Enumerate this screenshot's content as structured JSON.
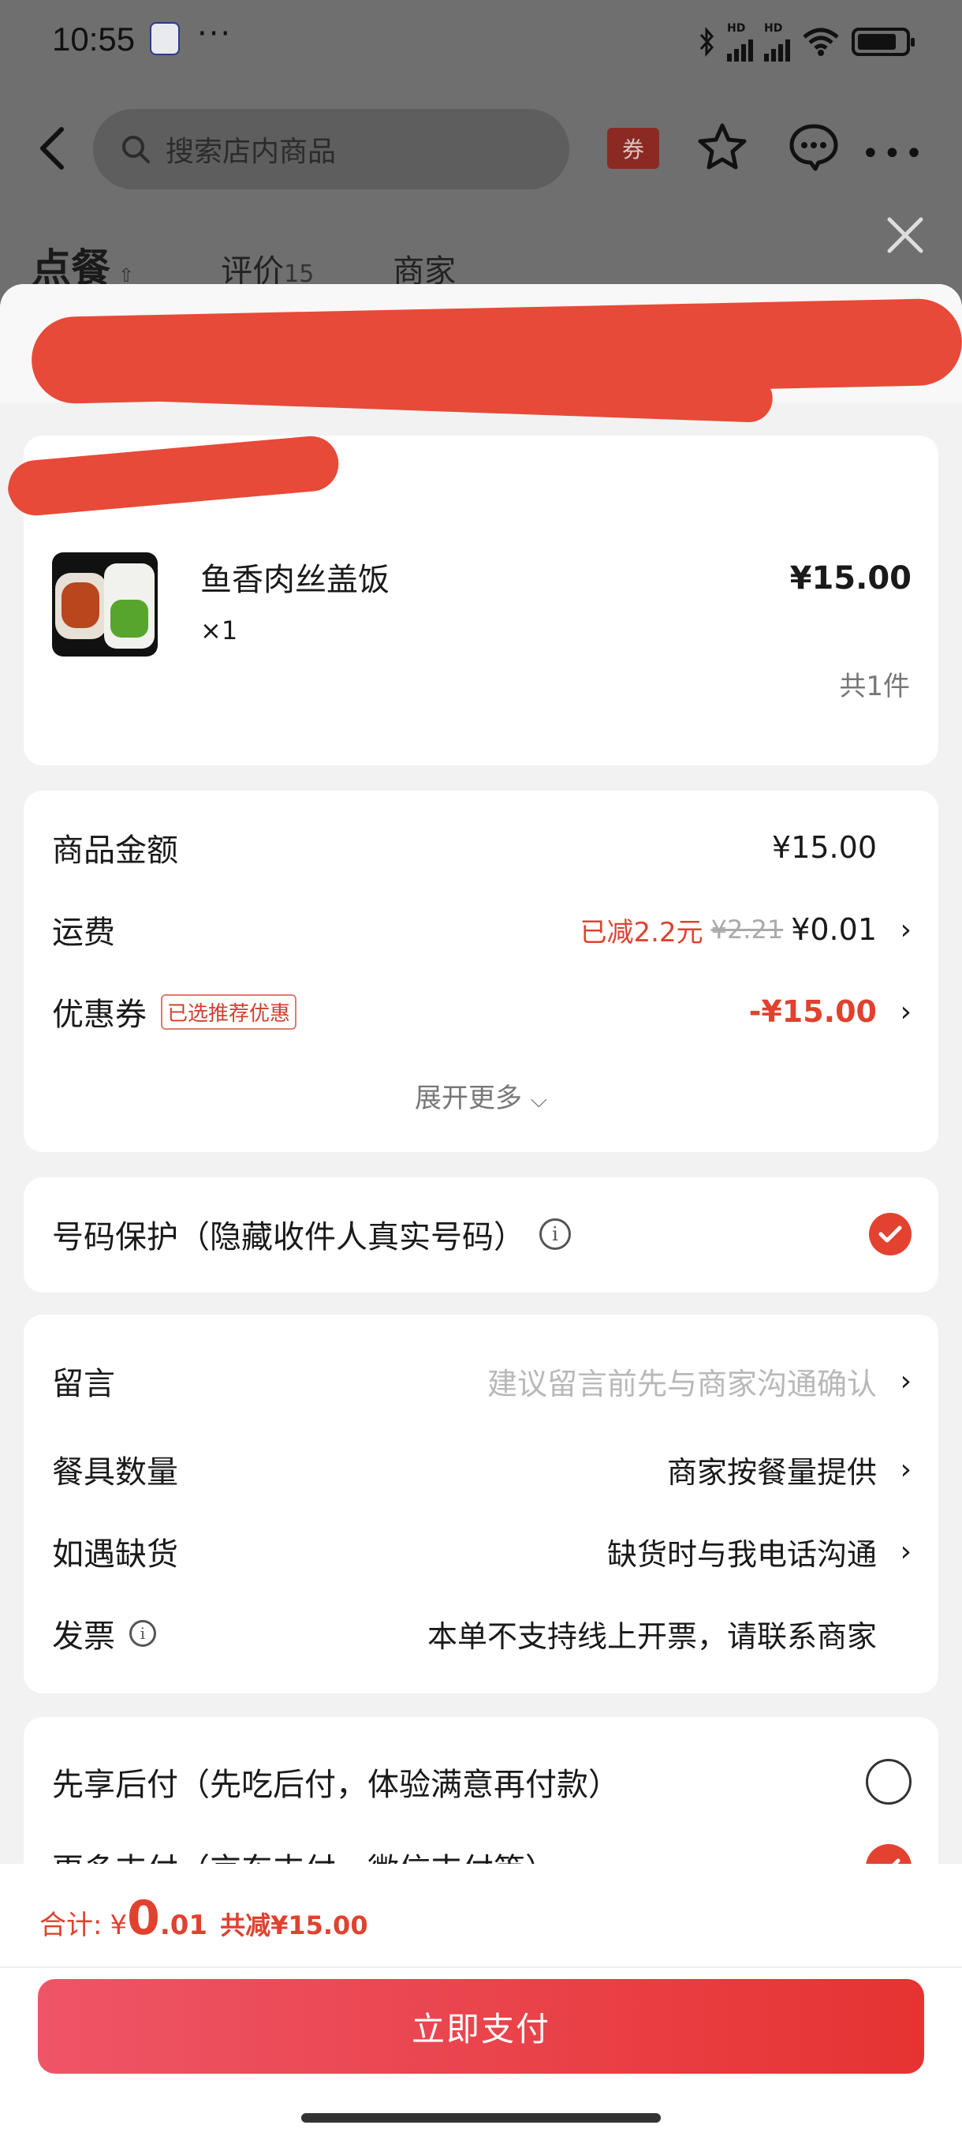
{
  "status_bar": {
    "time": "10:55",
    "dots": "···",
    "hd1": "HD",
    "hd2": "HD"
  },
  "header": {
    "search_placeholder": "搜索店内商品",
    "coupon_label": "券"
  },
  "tabs": {
    "order": "点餐",
    "reviews": "评价",
    "reviews_count": "15",
    "merchant": "商家"
  },
  "product": {
    "name": "鱼香肉丝盖饭",
    "quantity": "×1",
    "price": "¥15.00",
    "count_total": "共1件"
  },
  "fees": {
    "goods_label": "商品金额",
    "goods_amount": "¥15.00",
    "shipping_label": "运费",
    "shipping_discount": "已减2.2元",
    "shipping_original": "¥2.21",
    "shipping_amount": "¥0.01",
    "coupon_label": "优惠券",
    "coupon_badge": "已选推荐优惠",
    "coupon_amount": "-¥15.00",
    "expand_more": "展开更多"
  },
  "privacy": {
    "label": "号码保护（隐藏收件人真实号码）"
  },
  "options": {
    "message_label": "留言",
    "message_placeholder": "建议留言前先与商家沟通确认",
    "tableware_label": "餐具数量",
    "tableware_value": "商家按餐量提供",
    "stockout_label": "如遇缺货",
    "stockout_value": "缺货时与我电话沟通",
    "invoice_label": "发票",
    "invoice_value": "本单不支持线上开票，请联系商家"
  },
  "payment": {
    "paylater_label": "先享后付（先吃后付，体验满意再付款）",
    "more_label": "更多支付（京东支付、微信支付等）"
  },
  "bottom": {
    "total_label": "合计:",
    "currency": "¥",
    "total_int": "0",
    "total_dec": ".01",
    "total_saved": "共减¥15.00",
    "pay_button": "立即支付"
  },
  "colors": {
    "accent": "#e0422f",
    "pay_button_start": "#ee5567",
    "pay_button_end": "#e63332"
  }
}
